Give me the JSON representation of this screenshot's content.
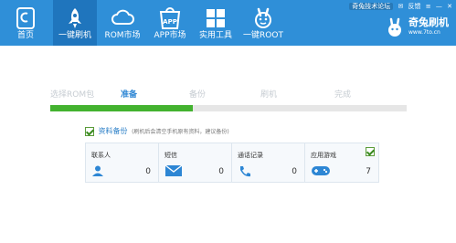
{
  "top_links": {
    "forum": "奇兔技术论坛",
    "feedback": "反馈"
  },
  "brand": {
    "name": "奇兔刷机",
    "url": "www.7to.cn"
  },
  "nav": [
    {
      "label": "首页",
      "icon": "home-icon"
    },
    {
      "label": "一键刷机",
      "icon": "rocket-icon"
    },
    {
      "label": "ROM市场",
      "icon": "cloud-icon"
    },
    {
      "label": "APP市场",
      "icon": "app-store-icon"
    },
    {
      "label": "实用工具",
      "icon": "tools-grid-icon"
    },
    {
      "label": "一键ROOT",
      "icon": "root-bunny-icon"
    }
  ],
  "active_nav": 1,
  "steps": [
    {
      "label": "选择ROM包"
    },
    {
      "label": "准备"
    },
    {
      "label": "备份"
    },
    {
      "label": "刷机"
    },
    {
      "label": "完成"
    }
  ],
  "current_step": 1,
  "progress_fraction": 0.4,
  "backup": {
    "label": "资料备份",
    "note": "(刷机后会清空手机原有资料，建议备份)"
  },
  "cards": [
    {
      "title": "联系人",
      "count": "0",
      "icon": "contacts-icon"
    },
    {
      "title": "短信",
      "count": "0",
      "icon": "sms-envelope-icon"
    },
    {
      "title": "通话记录",
      "count": "0",
      "icon": "phone-call-icon"
    },
    {
      "title": "应用游戏",
      "count": "7",
      "icon": "gamepad-icon",
      "checked": true
    }
  ],
  "colors": {
    "topbar": "#2f8fd8",
    "active_nav": "#1f75bd",
    "progress": "#43b22f",
    "accent": "#2d86d4"
  }
}
